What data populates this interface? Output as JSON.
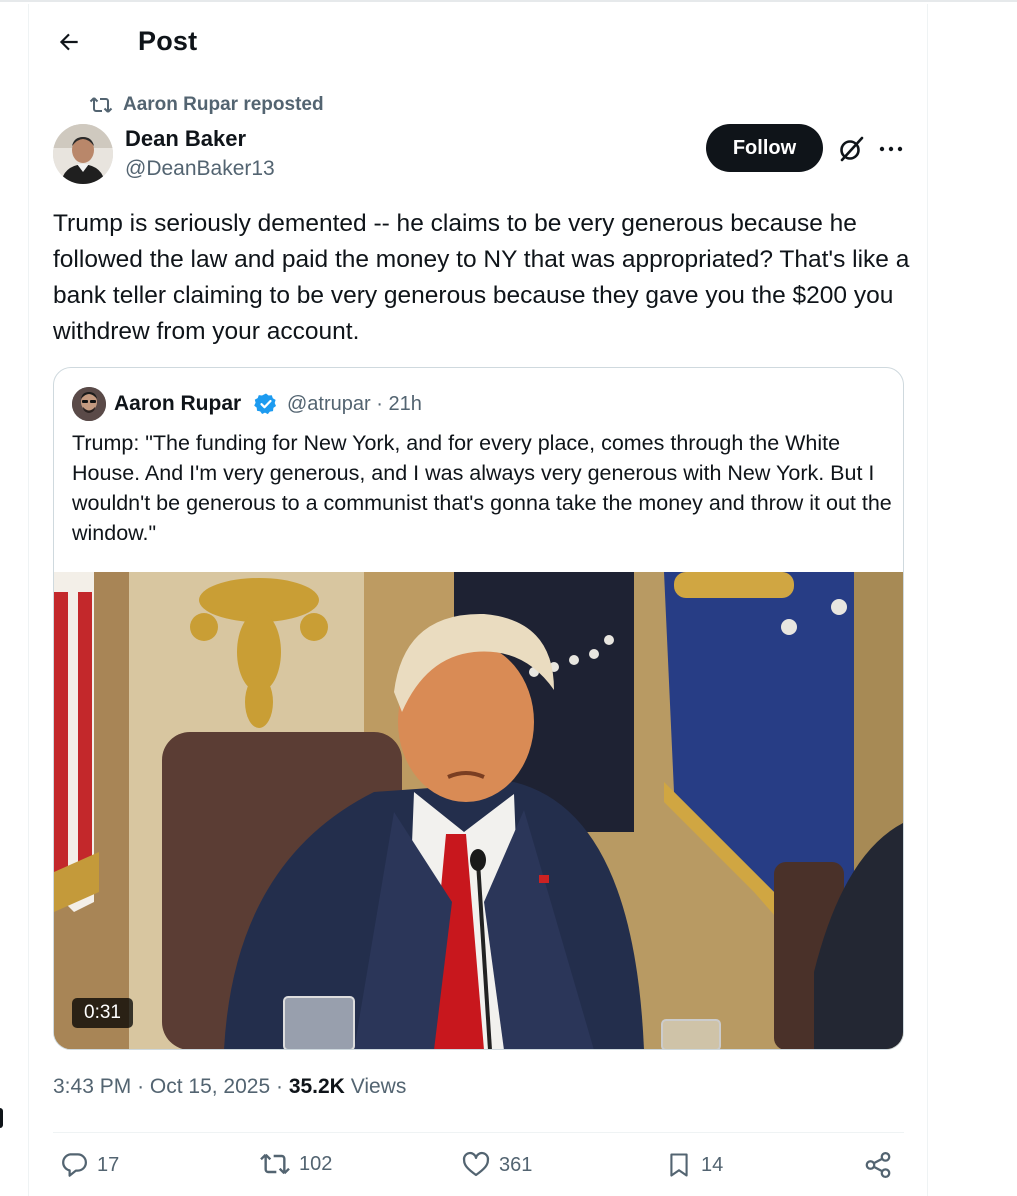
{
  "header": {
    "title": "Post"
  },
  "repost": {
    "text": "Aaron Rupar reposted"
  },
  "author": {
    "name": "Dean Baker",
    "handle": "@DeanBaker13",
    "follow_label": "Follow"
  },
  "post": {
    "text": "Trump is seriously demented -- he claims to be very generous because he followed the law and paid the money to NY that was appropriated? That's like a bank teller claiming to be very generous because they gave you the $200 you withdrew from your account."
  },
  "quote": {
    "name": "Aaron Rupar",
    "handle": "@atrupar",
    "time": "21h",
    "text": "Trump: \"The funding for New York, and for every place, comes through the White House. And I'm very generous, and I was always very generous with New York. But I wouldn't be generous to a communist that's gonna take the money and throw it out the window.\"",
    "video_duration": "0:31",
    "verified_color": "#1d9bf0"
  },
  "meta": {
    "time": "3:43 PM",
    "date": "Oct 15, 2025",
    "views_count": "35.2K",
    "views_label": "Views"
  },
  "actions": {
    "replies": "17",
    "reposts": "102",
    "likes": "361",
    "bookmarks": "14"
  },
  "icons": [
    "back-arrow-icon",
    "repost-icon",
    "grok-icon",
    "more-icon",
    "verified-badge-icon",
    "reply-icon",
    "like-icon",
    "bookmark-icon",
    "share-icon"
  ]
}
